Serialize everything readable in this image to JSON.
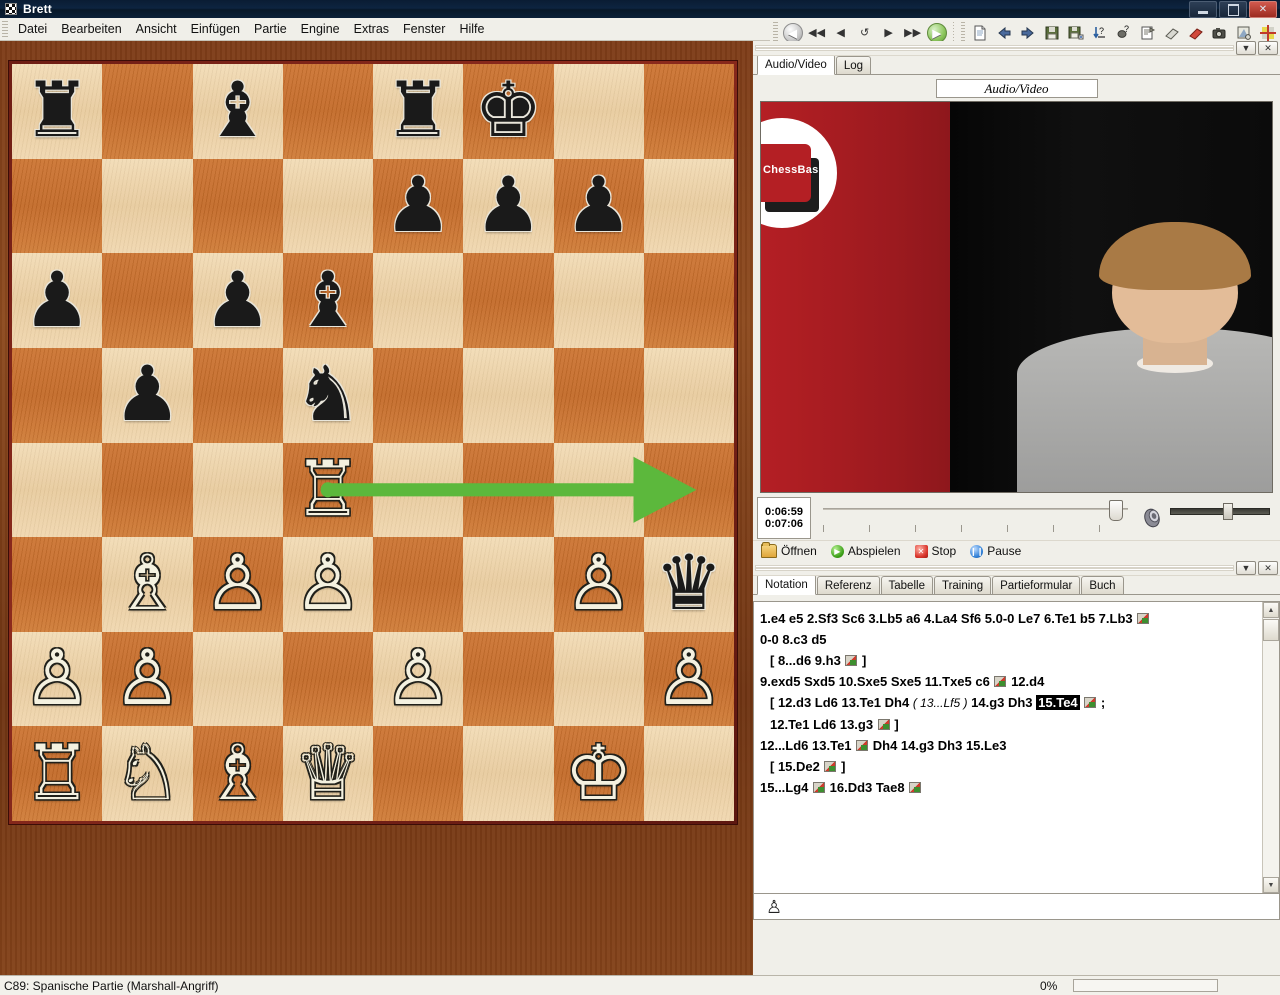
{
  "window": {
    "title": "Brett",
    "icon": "chessboard-icon",
    "buttons": {
      "minimize": "–",
      "maximize": "❐",
      "close": "✕"
    }
  },
  "menu": {
    "items": [
      "Datei",
      "Bearbeiten",
      "Ansicht",
      "Einfügen",
      "Partie",
      "Engine",
      "Extras",
      "Fenster",
      "Hilfe"
    ]
  },
  "toolbar": {
    "nav": [
      {
        "name": "back-button",
        "glyph": "◀"
      },
      {
        "name": "first-move-button",
        "glyph": "|◀"
      },
      {
        "name": "previous-move-button",
        "glyph": "◀"
      },
      {
        "name": "takeback-button",
        "glyph": "↺"
      },
      {
        "name": "next-move-button",
        "glyph": "▶"
      },
      {
        "name": "last-move-button",
        "glyph": "▶|"
      },
      {
        "name": "forward-button",
        "glyph": "▶"
      }
    ],
    "actions": [
      {
        "name": "new-game-icon",
        "glyph": "🗎"
      },
      {
        "name": "previous-game-icon",
        "glyph": "⬅"
      },
      {
        "name": "next-game-icon",
        "glyph": "➡"
      },
      {
        "name": "save-icon",
        "glyph": "💾"
      },
      {
        "name": "save-as-icon",
        "glyph": "💾"
      },
      {
        "name": "sort-annotate-icon",
        "glyph": "↓?"
      },
      {
        "name": "comment-icon",
        "glyph": "✎?"
      },
      {
        "name": "properties-icon",
        "glyph": "🗒"
      },
      {
        "name": "eraser-grey-icon",
        "glyph": "▰"
      },
      {
        "name": "eraser-red-icon",
        "glyph": "▰"
      },
      {
        "name": "camera-icon",
        "glyph": "📷"
      },
      {
        "name": "paint-icon",
        "glyph": "🎨"
      },
      {
        "name": "colors-icon",
        "glyph": "✛"
      }
    ]
  },
  "board": {
    "squares": [
      [
        "br",
        "",
        "bb",
        "",
        "br",
        "bk",
        "",
        ""
      ],
      [
        "",
        "",
        "",
        "",
        "bp",
        "bp",
        "bp",
        ""
      ],
      [
        "bp",
        "",
        "bp",
        "bb",
        "",
        "",
        "",
        ""
      ],
      [
        "",
        "bp",
        "",
        "bn",
        "",
        "",
        "",
        ""
      ],
      [
        "",
        "",
        "",
        "wr",
        "",
        "",
        "",
        ""
      ],
      [
        "",
        "wb",
        "wp",
        "wp",
        "",
        "",
        "wp",
        "bq"
      ],
      [
        "wp",
        "wp",
        "",
        "",
        "wp",
        "",
        "",
        "wp"
      ],
      [
        "wr",
        "wn",
        "wb",
        "wq",
        "",
        "",
        "wk",
        ""
      ]
    ],
    "arrow": {
      "name": "move-arrow",
      "from": "d4",
      "to": "h4",
      "color": "#5cb83c"
    },
    "light_square_color": "#edd3a8",
    "dark_square_color": "#c96f2c",
    "frame_color": "#7b2116"
  },
  "board_status": {
    "text": "C89: Spanische Partie (Marshall-Angriff)"
  },
  "video_panel": {
    "tabs": [
      {
        "label": "Audio/Video",
        "active": true
      },
      {
        "label": "Log",
        "active": false
      }
    ],
    "caption": "Audio/Video",
    "banner_text": "ChessBase",
    "collapse_glyph": "▼",
    "close_glyph": "✕"
  },
  "media": {
    "time_current": "0:06:59",
    "time_total": "0:07:06",
    "buttons": [
      {
        "label": "Öffnen",
        "icon": "open-folder-icon"
      },
      {
        "label": "Abspielen",
        "icon": "play-icon"
      },
      {
        "label": "Stop",
        "icon": "stop-icon"
      },
      {
        "label": "Pause",
        "icon": "pause-icon"
      }
    ],
    "speaker_icon": "speaker-icon"
  },
  "notation_panel": {
    "tabs": [
      {
        "label": "Notation",
        "active": true
      },
      {
        "label": "Referenz",
        "active": false
      },
      {
        "label": "Tabelle",
        "active": false
      },
      {
        "label": "Training",
        "active": false
      },
      {
        "label": "Partieformular",
        "active": false
      },
      {
        "label": "Buch",
        "active": false
      }
    ],
    "collapse_glyph": "▼",
    "close_glyph": "✕",
    "lines": [
      {
        "type": "main",
        "html": "1.e4  e5  2.Sf3  Sc6  3.Lb5  a6  4.La4  Sf6  5.0-0  Le7  6.Te1  b5  7.Lb3 <span class=\"medal\"></span>"
      },
      {
        "type": "main",
        "html": "0-0  8.c3  d5"
      },
      {
        "type": "var",
        "html": "[ 8...d6  9.h3 <span class=\"medal\"></span> ]"
      },
      {
        "type": "main",
        "html": "9.exd5  Sxd5  10.Sxe5  Sxe5  11.Txe5  c6 <span class=\"medal\"></span>  12.d4"
      },
      {
        "type": "var",
        "html": "[ 12.d3  Ld6  13.Te1  Dh4 <span class=\"italic\">( 13...Lf5 )</span> 14.g3  Dh3 <span class=\"hl\">15.Te4</span> <span class=\"medal\"></span> ;"
      },
      {
        "type": "var",
        "html": "12.Te1  Ld6  13.g3 <span class=\"medal\"></span> ]"
      },
      {
        "type": "main",
        "html": "12...Ld6  13.Te1 <span class=\"medal\"></span>  Dh4  14.g3  Dh3  15.Le3"
      },
      {
        "type": "var",
        "html": "[ 15.De2 <span class=\"medal\"></span> ]"
      },
      {
        "type": "main",
        "html": "15...Lg4 <span class=\"medal\"></span>  16.Dd3  Tae8 <span class=\"medal\"></span>"
      }
    ],
    "highlighted_move": "15.Te4",
    "engine_strip_icon": "white-pawn-icon"
  },
  "right_status": {
    "progress_label": "0%",
    "progress_value": 0
  }
}
